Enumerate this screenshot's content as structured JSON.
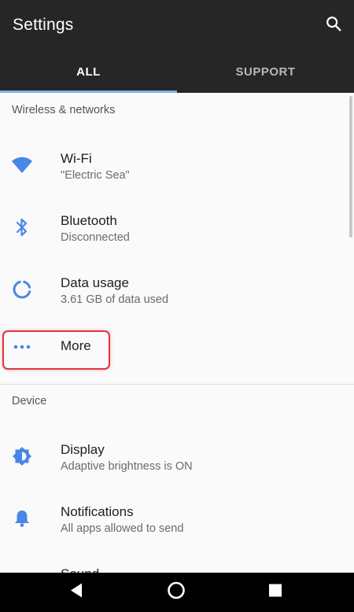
{
  "appbar": {
    "title": "Settings",
    "search_icon": "search-icon"
  },
  "tabs": [
    {
      "label": "ALL",
      "active": true
    },
    {
      "label": "SUPPORT",
      "active": false
    }
  ],
  "sections": [
    {
      "header": "Wireless & networks",
      "items": [
        {
          "title": "Wi-Fi",
          "subtitle": "\"Electric Sea\"",
          "icon": "wifi-icon"
        },
        {
          "title": "Bluetooth",
          "subtitle": "Disconnected",
          "icon": "bluetooth-icon"
        },
        {
          "title": "Data usage",
          "subtitle": "3.61 GB of data used",
          "icon": "data-usage-icon"
        },
        {
          "title": "More",
          "icon": "more-dots-icon"
        }
      ]
    },
    {
      "header": "Device",
      "items": [
        {
          "title": "Display",
          "subtitle": "Adaptive brightness is ON",
          "icon": "brightness-icon"
        },
        {
          "title": "Notifications",
          "subtitle": "All apps allowed to send",
          "icon": "bell-icon"
        },
        {
          "title": "Sound",
          "icon": "sound-icon"
        }
      ]
    }
  ],
  "colors": {
    "appbar": "#262626",
    "accent": "#4a86e8",
    "highlight": "#e1343d"
  },
  "navbar": {
    "back": "back-icon",
    "home": "home-icon",
    "recents": "recents-icon"
  }
}
